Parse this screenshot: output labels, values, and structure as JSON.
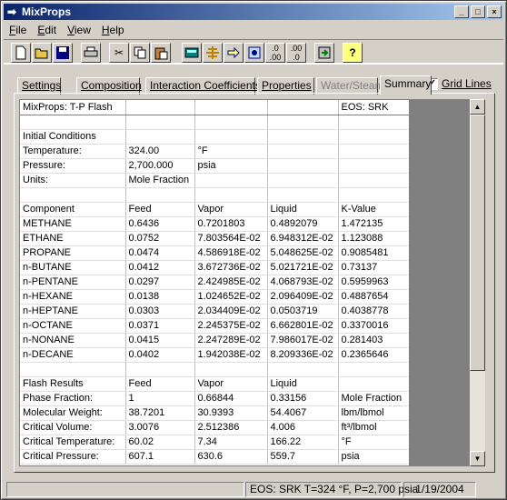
{
  "window": {
    "title": "MixProps",
    "icon": "arrow-app-icon"
  },
  "menu": [
    {
      "label": "File",
      "key": "F"
    },
    {
      "label": "Edit",
      "key": "E"
    },
    {
      "label": "View",
      "key": "V"
    },
    {
      "label": "Help",
      "key": "H"
    }
  ],
  "toolbar": {
    "buttons": [
      "new-file-icon",
      "open-folder-icon",
      "save-icon",
      "print-icon",
      "cut-icon",
      "copy-icon",
      "paste-icon",
      "calculator-icon",
      "crosshair-icon",
      "arrow-right-icon",
      "properties-icon",
      "decimal-increase-icon",
      "decimal-decrease-icon",
      "export-icon",
      "help-icon"
    ]
  },
  "tabs": [
    {
      "label": "Settings",
      "state": "normal"
    },
    {
      "label": "Composition",
      "state": "normal"
    },
    {
      "label": "Interaction Coefficients",
      "state": "normal"
    },
    {
      "label": "Properties",
      "state": "normal"
    },
    {
      "label": "Water/Steam",
      "state": "disabled"
    },
    {
      "label": "Summary",
      "state": "active"
    }
  ],
  "grid_lines": {
    "label": "Grid Lines",
    "checked": true,
    "check": "✓"
  },
  "sheet": {
    "rows": [
      [
        "MixProps: T-P Flash",
        "",
        "",
        "",
        "EOS: SRK"
      ],
      [
        "",
        "",
        "",
        "",
        ""
      ],
      [
        "Initial Conditions",
        "",
        "",
        "",
        ""
      ],
      [
        "Temperature:",
        "324.00",
        "°F",
        "",
        ""
      ],
      [
        "Pressure:",
        "2,700.000",
        "psia",
        "",
        ""
      ],
      [
        "Units:",
        "Mole Fraction",
        "",
        "",
        ""
      ],
      [
        "",
        "",
        "",
        "",
        ""
      ],
      [
        "Component",
        "Feed",
        "Vapor",
        "Liquid",
        "K-Value"
      ],
      [
        "METHANE",
        "0.6436",
        "0.7201803",
        "0.4892079",
        "1.472135"
      ],
      [
        "ETHANE",
        "0.0752",
        "7.803564E-02",
        "6.948312E-02",
        "1.123088"
      ],
      [
        "PROPANE",
        "0.0474",
        "4.586918E-02",
        "5.048625E-02",
        "0.9085481"
      ],
      [
        "n-BUTANE",
        "0.0412",
        "3.672736E-02",
        "5.021721E-02",
        "0.73137"
      ],
      [
        "n-PENTANE",
        "0.0297",
        "2.424985E-02",
        "4.068793E-02",
        "0.5959963"
      ],
      [
        "n-HEXANE",
        "0.0138",
        "1.024652E-02",
        "2.096409E-02",
        "0.4887654"
      ],
      [
        "n-HEPTANE",
        "0.0303",
        "2.034409E-02",
        "0.0503719",
        "0.4038778"
      ],
      [
        "n-OCTANE",
        "0.0371",
        "2.245375E-02",
        "6.662801E-02",
        "0.3370016"
      ],
      [
        "n-NONANE",
        "0.0415",
        "2.247289E-02",
        "7.986017E-02",
        "0.281403"
      ],
      [
        "n-DECANE",
        "0.0402",
        "1.942038E-02",
        "8.209336E-02",
        "0.2365646"
      ],
      [
        "",
        "",
        "",
        "",
        ""
      ],
      [
        "Flash Results",
        "Feed",
        "Vapor",
        "Liquid",
        ""
      ],
      [
        "Phase Fraction:",
        "1",
        "0.66844",
        "0.33156",
        "Mole Fraction"
      ],
      [
        "Molecular Weight:",
        "38.7201",
        "30.9393",
        "54.4067",
        "lbm/lbmol"
      ],
      [
        "Critical Volume:",
        "3.0076",
        "2.512386",
        "4.006",
        "ft³/lbmol"
      ],
      [
        "Critical Temperature:",
        "60.02",
        "7.34",
        "166.22",
        "°F"
      ],
      [
        "Critical Pressure:",
        "607.1",
        "630.6",
        "559.7",
        "psia"
      ]
    ]
  },
  "scrollbar": {
    "up": "▲",
    "down": "▼"
  },
  "status": {
    "eos_text": "EOS: SRK  T=324 °F, P=2,700 psia",
    "date": "1/19/2004"
  },
  "caption_buttons": {
    "minimize": "_",
    "maximize": "□",
    "close": "×"
  },
  "colors": {
    "title_start": "#0a246a",
    "title_end": "#a6caf0",
    "face": "#d4d0c8"
  }
}
